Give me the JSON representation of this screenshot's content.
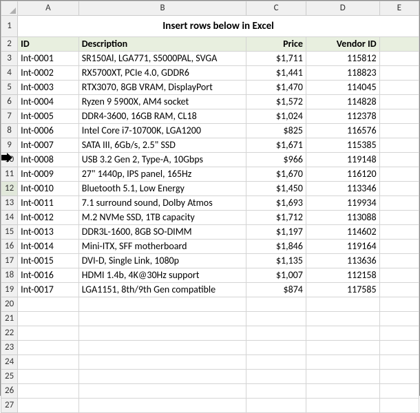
{
  "columns": [
    "A",
    "B",
    "C",
    "D",
    "E"
  ],
  "title": "Insert rows below in Excel",
  "headers": {
    "id": "ID",
    "desc": "Description",
    "price": "Price",
    "vendor": "Vendor ID"
  },
  "rows": [
    {
      "id": "Int-0001",
      "desc": "SR150Al, LGA771, S5000PAL, SVGA",
      "price": "$1,711",
      "vendor": "115812"
    },
    {
      "id": "Int-0002",
      "desc": "RX5700XT, PCIe 4.0, GDDR6",
      "price": "$1,441",
      "vendor": "118823"
    },
    {
      "id": "Int-0003",
      "desc": "RTX3070, 8GB VRAM, DisplayPort",
      "price": "$1,470",
      "vendor": "114045"
    },
    {
      "id": "Int-0004",
      "desc": "Ryzen 9 5900X, AM4 socket",
      "price": "$1,572",
      "vendor": "114828"
    },
    {
      "id": "Int-0005",
      "desc": "DDR4-3600, 16GB RAM, CL18",
      "price": "$1,024",
      "vendor": "112378"
    },
    {
      "id": "Int-0006",
      "desc": "Intel Core i7-10700K, LGA1200",
      "price": "$825",
      "vendor": "116576"
    },
    {
      "id": "Int-0007",
      "desc": "SATA III, 6Gb/s, 2.5\" SSD",
      "price": "$1,671",
      "vendor": "115385"
    },
    {
      "id": "Int-0008",
      "desc": "USB 3.2 Gen 2, Type-A, 10Gbps",
      "price": "$966",
      "vendor": "119148"
    },
    {
      "id": "Int-0009",
      "desc": "27\" 1440p, IPS panel, 165Hz",
      "price": "$1,670",
      "vendor": "116120"
    },
    {
      "id": "Int-0010",
      "desc": "Bluetooth 5.1, Low Energy",
      "price": "$1,450",
      "vendor": "113346"
    },
    {
      "id": "Int-0011",
      "desc": "7.1 surround sound, Dolby Atmos",
      "price": "$1,693",
      "vendor": "119934"
    },
    {
      "id": "Int-0012",
      "desc": "M.2 NVMe SSD, 1TB capacity",
      "price": "$1,712",
      "vendor": "113088"
    },
    {
      "id": "Int-0013",
      "desc": "DDR3L-1600, 8GB SO-DIMM",
      "price": "$1,197",
      "vendor": "114602"
    },
    {
      "id": "Int-0014",
      "desc": "Mini-ITX, SFF motherboard",
      "price": "$1,846",
      "vendor": "119164"
    },
    {
      "id": "Int-0015",
      "desc": "DVI-D, Single Link, 1080p",
      "price": "$1,135",
      "vendor": "113636"
    },
    {
      "id": "Int-0016",
      "desc": "HDMI 1.4b, 4K@30Hz support",
      "price": "$1,007",
      "vendor": "112158"
    },
    {
      "id": "Int-0017",
      "desc": "LGA1151, 8th/9th Gen compatible",
      "price": "$874",
      "vendor": "117585"
    }
  ],
  "selected_row_header": 12,
  "total_rows": 27,
  "chart_data": {
    "type": "table",
    "title": "Insert rows below in Excel",
    "columns": [
      "ID",
      "Description",
      "Price",
      "Vendor ID"
    ],
    "data": [
      [
        "Int-0001",
        "SR150Al, LGA771, S5000PAL, SVGA",
        1711,
        115812
      ],
      [
        "Int-0002",
        "RX5700XT, PCIe 4.0, GDDR6",
        1441,
        118823
      ],
      [
        "Int-0003",
        "RTX3070, 8GB VRAM, DisplayPort",
        1470,
        114045
      ],
      [
        "Int-0004",
        "Ryzen 9 5900X, AM4 socket",
        1572,
        114828
      ],
      [
        "Int-0005",
        "DDR4-3600, 16GB RAM, CL18",
        1024,
        112378
      ],
      [
        "Int-0006",
        "Intel Core i7-10700K, LGA1200",
        825,
        116576
      ],
      [
        "Int-0007",
        "SATA III, 6Gb/s, 2.5\" SSD",
        1671,
        115385
      ],
      [
        "Int-0008",
        "USB 3.2 Gen 2, Type-A, 10Gbps",
        966,
        119148
      ],
      [
        "Int-0009",
        "27\" 1440p, IPS panel, 165Hz",
        1670,
        116120
      ],
      [
        "Int-0010",
        "Bluetooth 5.1, Low Energy",
        1450,
        113346
      ],
      [
        "Int-0011",
        "7.1 surround sound, Dolby Atmos",
        1693,
        119934
      ],
      [
        "Int-0012",
        "M.2 NVMe SSD, 1TB capacity",
        1712,
        113088
      ],
      [
        "Int-0013",
        "DDR3L-1600, 8GB SO-DIMM",
        1197,
        114602
      ],
      [
        "Int-0014",
        "Mini-ITX, SFF motherboard",
        1846,
        119164
      ],
      [
        "Int-0015",
        "DVI-D, Single Link, 1080p",
        1135,
        113636
      ],
      [
        "Int-0016",
        "HDMI 1.4b, 4K@30Hz support",
        1007,
        112158
      ],
      [
        "Int-0017",
        "LGA1151, 8th/9th Gen compatible",
        874,
        117585
      ]
    ]
  }
}
